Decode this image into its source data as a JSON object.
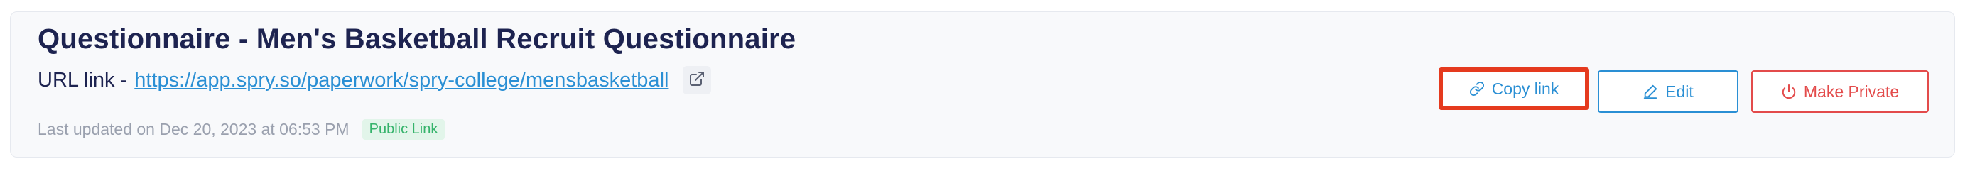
{
  "header": {
    "title": "Questionnaire - Men's Basketball Recruit Questionnaire",
    "url_prefix": "URL link -",
    "url": "https://app.spry.so/paperwork/spry-college/mensbasketball",
    "last_updated": "Last updated on Dec 20, 2023 at 06:53 PM",
    "badge": "Public Link"
  },
  "actions": {
    "copy_label": "Copy link",
    "edit_label": "Edit",
    "private_label": "Make Private"
  },
  "icons": {
    "external": "external-link-icon",
    "copy": "link-icon",
    "edit": "pencil-icon",
    "private": "power-icon"
  },
  "colors": {
    "title": "#1d2350",
    "link": "#2a8fd4",
    "danger": "#e34b4b",
    "badge_text": "#35b36b",
    "badge_bg": "#e2f5ea",
    "highlight": "#e53a1e"
  }
}
